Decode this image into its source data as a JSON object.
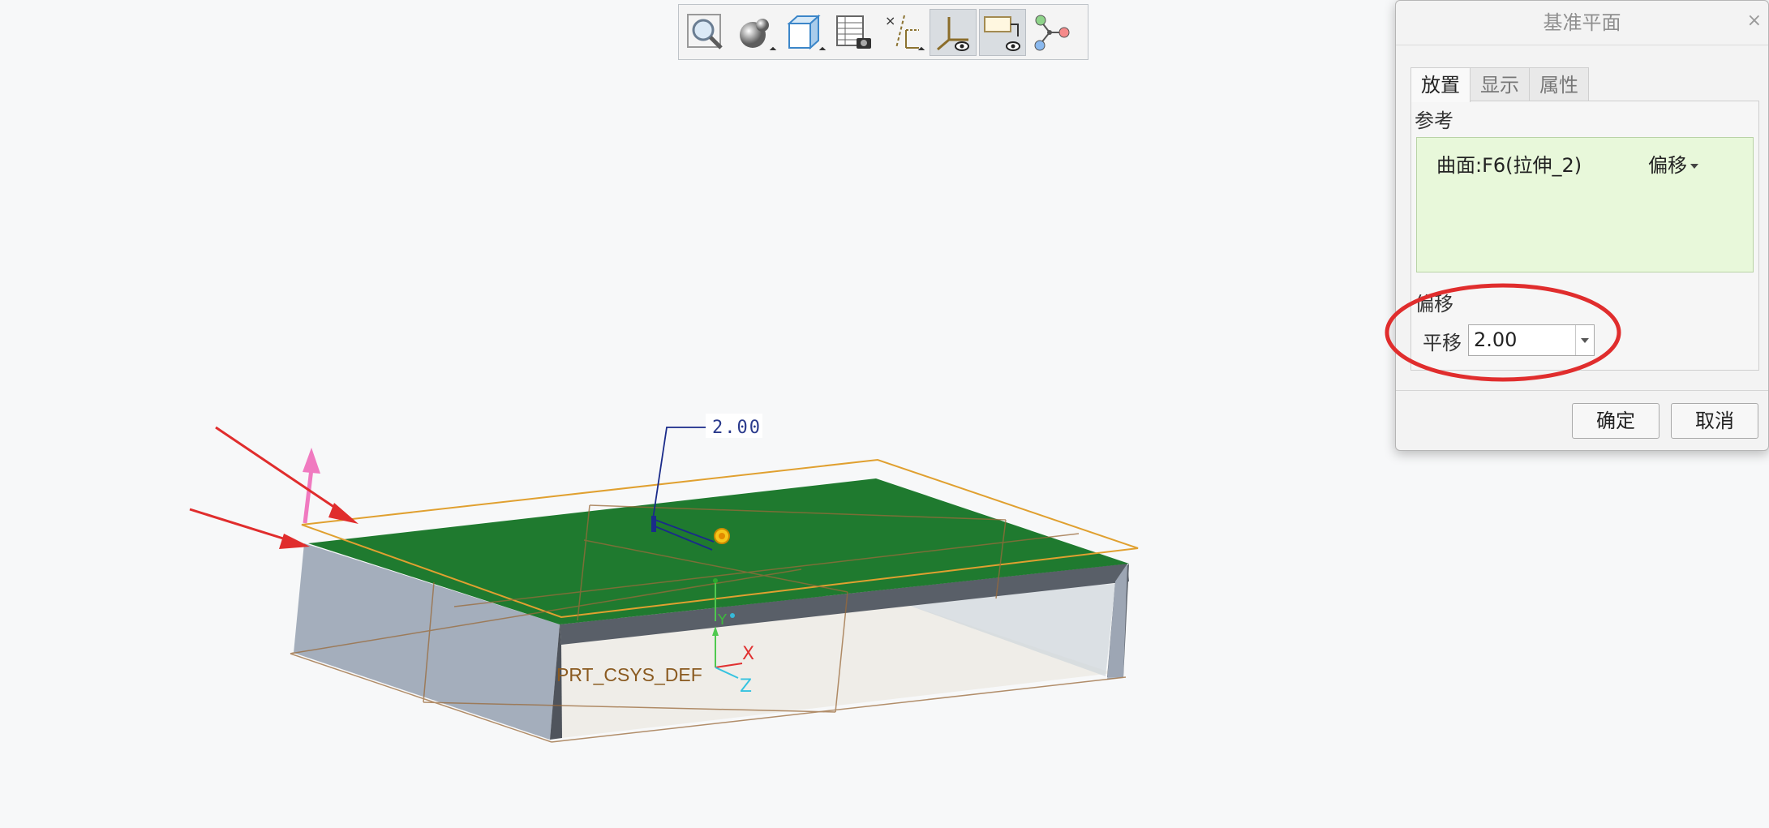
{
  "toolbar": {
    "buttons": [
      {
        "name": "zoom-icon",
        "pressed": false
      },
      {
        "name": "display-style-icon",
        "pressed": false
      },
      {
        "name": "saved-orientation-icon",
        "pressed": false
      },
      {
        "name": "view-manager-icon",
        "pressed": false
      },
      {
        "name": "datum-display-filters-icon",
        "pressed": false
      },
      {
        "name": "csys-display-icon",
        "pressed": true
      },
      {
        "name": "annotation-display-icon",
        "pressed": true
      },
      {
        "name": "point-display-icon",
        "pressed": false
      }
    ]
  },
  "viewport": {
    "dimension_value": "2.00",
    "csys_label": "PRT_CSYS_DEF",
    "axis_x": "X",
    "axis_y": "Y",
    "axis_z": "Z",
    "colors": {
      "surface": "#1f7a2f",
      "walls": "#a8b2bf",
      "datum_plane": "#e0a030",
      "annotation_arrow": "#e02d2d",
      "normal_arrow": "#f07ac0"
    }
  },
  "dialog": {
    "title": "基准平面",
    "close": "×",
    "tabs": [
      {
        "label": "放置",
        "active": true
      },
      {
        "label": "显示",
        "active": false
      },
      {
        "label": "属性",
        "active": false
      }
    ],
    "references_label": "参考",
    "reference": {
      "name": "曲面:F6(拉伸_2)",
      "constraint": "偏移"
    },
    "offset_label": "偏移",
    "translate_label": "平移",
    "translate_value": "2.00",
    "ok_label": "确定",
    "cancel_label": "取消"
  }
}
